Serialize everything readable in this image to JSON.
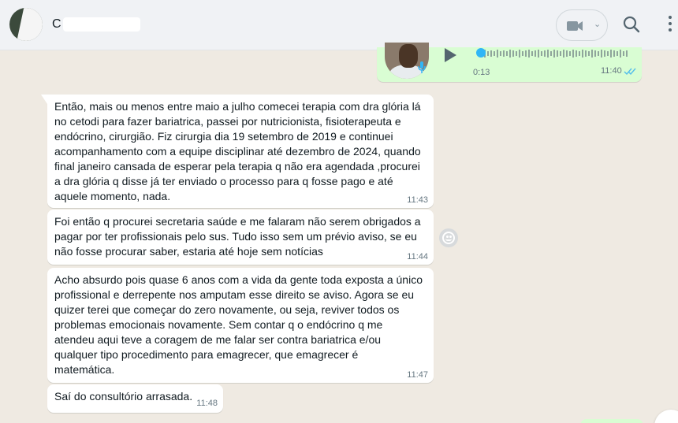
{
  "header": {
    "contact_initial": "C",
    "icons": [
      "video-call-icon",
      "chevron-down-icon",
      "search-icon",
      "menu-icon"
    ]
  },
  "voice_message": {
    "duration": "0:13",
    "time": "11:40",
    "status": "read"
  },
  "messages": [
    {
      "text": "Então,  mais ou menos entre maio a julho comecei terapia com dra glória lá\nno cetodi para fazer bariatrica,  passei por nutricionista, fisioterapeuta e\nendócrino, cirurgião. Fiz cirurgia dia 19 setembro de 2019 e continuei\nacompanhamento com a equipe disciplinar até dezembro de 2024, quando\nfinal janeiro cansada de esperar pela terapia q não era agendada ,procurei\na dra glória q disse já ter enviado o processo para q fosse pago e até\naquele momento, nada.",
      "time": "11:43"
    },
    {
      "text": "Foi então q procurei secretaria saúde e me falaram não serem obrigados a\npagar por ter profissionais pelo sus. Tudo isso sem um prévio aviso, se eu\nnão fosse procurar saber, estaria até hoje sem notícias",
      "time": "11:44"
    },
    {
      "text": "Acho absurdo pois quase 6 anos com a vida da gente toda exposta a único\nprofissional e derrepente nos amputam esse direito se aviso. Agora se eu\nquizer terei que começar do zero novamente, ou seja, reviver todos os\nproblemas emocionais novamente. Sem contar q o endócrino q me\natendeu aqui teve a coragem de me falar ser contra bariatrica e/ou\nqualquer tipo procedimento para emagrecer,  que emagrecer é\nmatemática.",
      "time": "11:47"
    },
    {
      "text": "Saí do consultório arrasada.",
      "time": "11:48"
    }
  ]
}
